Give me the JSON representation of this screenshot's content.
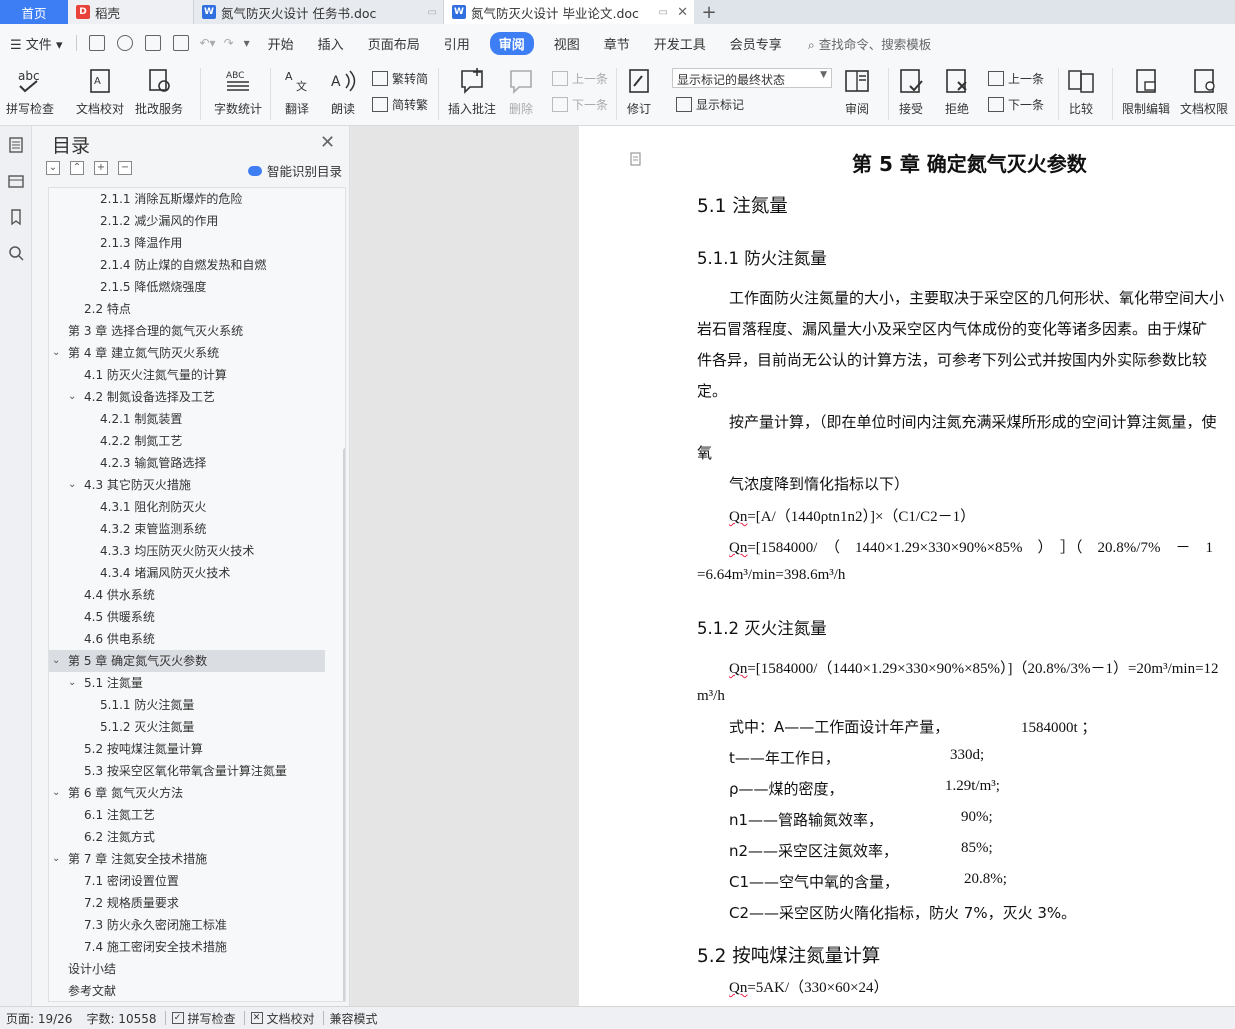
{
  "tabs": {
    "home": "首页",
    "daoke": "稻壳",
    "doc1": "氮气防灭火设计 任务书.doc",
    "doc2": "氮气防灭火设计 毕业论文.doc",
    "plus": "+"
  },
  "menu": {
    "file": "文件",
    "items": [
      "开始",
      "插入",
      "页面布局",
      "引用",
      "审阅",
      "视图",
      "章节",
      "开发工具",
      "会员专享"
    ],
    "search": "查找命令、搜索模板"
  },
  "ribbon": {
    "spell": "拼写检查",
    "proof": "文档校对",
    "correct": "批改服务",
    "wordcount": "字数统计",
    "translate": "翻译",
    "read": "朗读",
    "trad": "繁转简",
    "simp": "简转繁",
    "insert_comment": "插入批注",
    "delete": "删除",
    "prev": "上一条",
    "next": "下一条",
    "track": "修订",
    "state_select": "显示标记的最终状态",
    "show_markup": "显示标记",
    "review": "审阅",
    "accept": "接受",
    "reject": "拒绝",
    "prev2": "上一条",
    "next2": "下一条",
    "compare": "比较",
    "restrict": "限制编辑",
    "perm": "文档权限"
  },
  "toc": {
    "title": "目录",
    "smart": "智能识别目录",
    "items": [
      {
        "text": "2.1.1 消除瓦斯爆炸的危险",
        "level": 3
      },
      {
        "text": "2.1.2 减少漏风的作用",
        "level": 3
      },
      {
        "text": "2.1.3 降温作用",
        "level": 3
      },
      {
        "text": "2.1.4 防止煤的自燃发热和自燃",
        "level": 3
      },
      {
        "text": "2.1.5 降低燃烧强度",
        "level": 3
      },
      {
        "text": "2.2 特点",
        "level": 2
      },
      {
        "text": "第 3 章  选择合理的氮气灭火系统",
        "level": 1
      },
      {
        "text": "第 4 章  建立氮气防灭火系统",
        "level": 1,
        "expanded": true
      },
      {
        "text": "4.1 防灭火注氮气量的计算",
        "level": 2
      },
      {
        "text": "4.2 制氮设备选择及工艺",
        "level": 2,
        "expanded": true
      },
      {
        "text": "4.2.1 制氮装置",
        "level": 3
      },
      {
        "text": "4.2.2 制氮工艺",
        "level": 3
      },
      {
        "text": "4.2.3 输氮管路选择",
        "level": 3
      },
      {
        "text": "4.3 其它防灭火措施",
        "level": 2,
        "expanded": true
      },
      {
        "text": "4.3.1 阻化剂防灭火",
        "level": 3
      },
      {
        "text": "4.3.2 束管监测系统",
        "level": 3
      },
      {
        "text": "4.3.3 均压防灭火防灭火技术",
        "level": 3
      },
      {
        "text": "4.3.4 堵漏风防灭火技术",
        "level": 3
      },
      {
        "text": "4.4 供水系统",
        "level": 2
      },
      {
        "text": "4.5 供暖系统",
        "level": 2
      },
      {
        "text": "4.6 供电系统",
        "level": 2
      },
      {
        "text": "第 5 章  确定氮气灭火参数",
        "level": 1,
        "expanded": true,
        "selected": true
      },
      {
        "text": "5.1 注氮量",
        "level": 2,
        "expanded": true
      },
      {
        "text": "5.1.1 防火注氮量",
        "level": 3
      },
      {
        "text": "5.1.2 灭火注氮量",
        "level": 3
      },
      {
        "text": "5.2 按吨煤注氮量计算",
        "level": 2
      },
      {
        "text": "5.3 按采空区氧化带氧含量计算注氮量",
        "level": 2
      },
      {
        "text": "第 6 章  氮气灭火方法",
        "level": 1,
        "expanded": true
      },
      {
        "text": "6.1 注氮工艺",
        "level": 2
      },
      {
        "text": "6.2 注氮方式",
        "level": 2
      },
      {
        "text": "第 7 章  注氮安全技术措施",
        "level": 1,
        "expanded": true
      },
      {
        "text": "7.1 密闭设置位置",
        "level": 2
      },
      {
        "text": "7.2 规格质量要求",
        "level": 2
      },
      {
        "text": "7.3 防火永久密闭施工标准",
        "level": 2
      },
      {
        "text": "7.4 施工密闭安全技术措施",
        "level": 2
      },
      {
        "text": "设计小结",
        "level": 1
      },
      {
        "text": "参考文献",
        "level": 1
      }
    ]
  },
  "doc": {
    "chapter": "第 5 章  确定氮气灭火参数",
    "s51": "5.1 注氮量",
    "s511": "5.1.1 防火注氮量",
    "p1a": "工作面防火注氮量的大小，主要取决于采空区的几何形状、氧化带空间大小",
    "p1b": "岩石冒落程度、漏风量大小及采空区内气体成份的变化等诸多因素。由于煤矿",
    "p1c": "件各异，目前尚无公认的计算方法，可参考下列公式并按国内外实际参数比较",
    "p1d": "定。",
    "p2a": "按产量计算，（即在单位时间内注氮充满采煤所形成的空间计算注氮量，使",
    "p2b": "氧",
    "p2c": "气浓度降到惰化指标以下）",
    "f1_qn": "Qn",
    "f1_rest": "=[A/（1440ρtn1n2）]×（C1/C2－1）",
    "f2_qn": "Qn",
    "f2_rest": "=[1584000/　（　1440×1.29×330×90%×85%　）　］（　20.8%/7%　－　1",
    "f2b": "=6.64m³/min=398.6m³/h",
    "s512": "5.1.2 灭火注氮量",
    "f3_qn": "Qn",
    "f3_rest": "=[1584000/（1440×1.29×330×90%×85%）]（20.8%/3%－1）=20m³/min=12",
    "f3b": "m³/h",
    "v1_label": "式中：A——工作面设计年产量，",
    "v1_val": "1584000t ；",
    "v2_label": "t——年工作日，",
    "v2_val": "330d;",
    "v3_label": "ρ——煤的密度，",
    "v3_val": "1.29t/m³;",
    "v4_label": "n1——管路输氮效率，",
    "v4_val": "90%;",
    "v5_label": "n2——采空区注氮效率，",
    "v5_val": "85%;",
    "v6_label": "C1——空气中氧的含量，",
    "v6_val": "20.8%;",
    "v7": "C2——采空区防火隋化指标，防火 7%，灭火 3%。",
    "s52": "5.2 按吨煤注氮量计算",
    "f4_qn": "Qn",
    "f4_rest": "=5AK/（330×60×24）"
  },
  "status": {
    "page": "页面: 19/26",
    "words": "字数: 10558",
    "spell": "拼写检查",
    "proof": "文档校对",
    "compat": "兼容模式"
  }
}
